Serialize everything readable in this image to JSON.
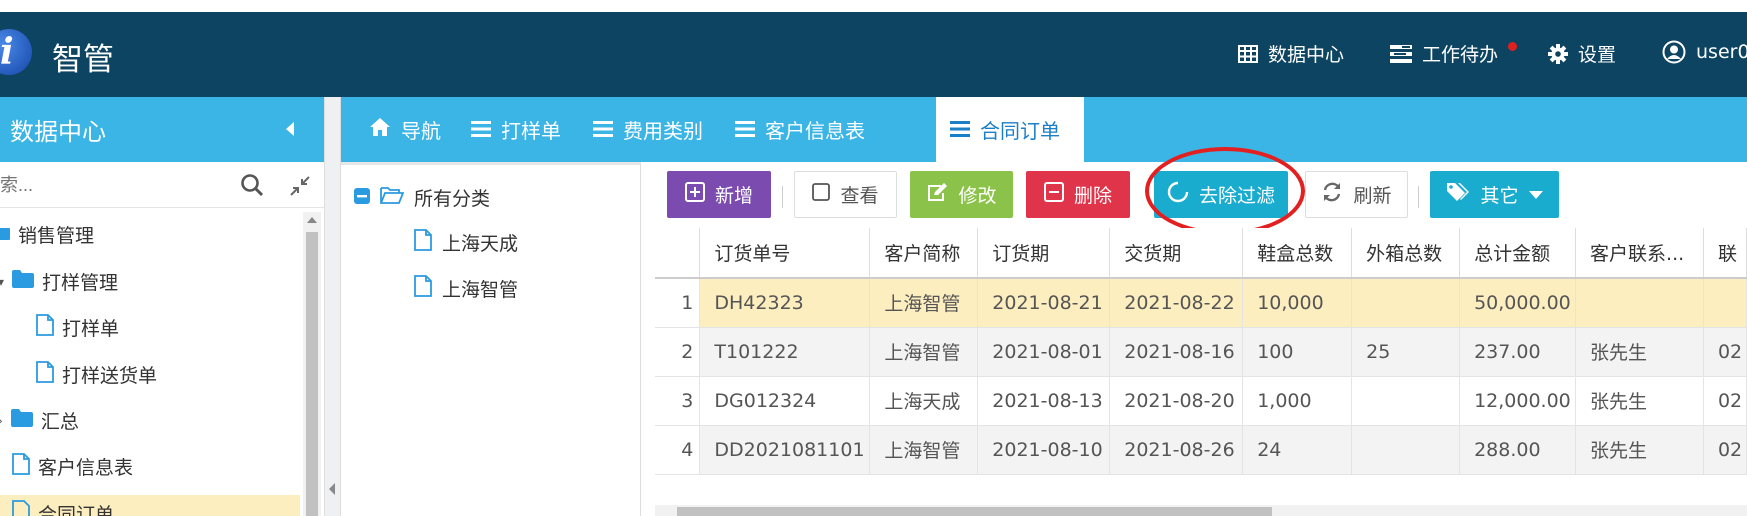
{
  "header": {
    "logo_letter": "i",
    "app_title": "智管",
    "items": [
      {
        "label": "数据中心",
        "icon": "table-icon"
      },
      {
        "label": "工作待办",
        "icon": "tasks-icon"
      },
      {
        "label": "设置",
        "icon": "gear-icon"
      },
      {
        "label": "user0",
        "icon": "user-icon"
      }
    ]
  },
  "sidebar": {
    "title": "数据中心",
    "search_placeholder": "索...",
    "tree": [
      {
        "label": "销售管理",
        "type": "folder-open"
      },
      {
        "label": "打样管理",
        "type": "folder"
      },
      {
        "label": "打样单",
        "type": "file"
      },
      {
        "label": "打样送货单",
        "type": "file"
      },
      {
        "label": "汇总",
        "type": "folder"
      },
      {
        "label": "客户信息表",
        "type": "file"
      },
      {
        "label": "合同订单",
        "type": "file"
      }
    ]
  },
  "tabs": [
    {
      "label": "导航",
      "icon": "home-icon"
    },
    {
      "label": "打样单",
      "icon": "list-icon"
    },
    {
      "label": "费用类别",
      "icon": "list-icon"
    },
    {
      "label": "客户信息表",
      "icon": "list-icon"
    },
    {
      "label": "合同订单",
      "icon": "list-icon",
      "active": true
    }
  ],
  "categories": {
    "root": "所有分类",
    "items": [
      "上海天成",
      "上海智管"
    ]
  },
  "toolbar": {
    "add": "新增",
    "view": "查看",
    "edit": "修改",
    "delete": "删除",
    "clear_filter": "去除过滤",
    "refresh": "刷新",
    "other": "其它"
  },
  "colors": {
    "header_bg": "#0d4462",
    "accent": "#3bb4e6",
    "add": "#7b4bb0",
    "edit": "#8bc34a",
    "delete": "#e0344a",
    "clear_filter": "#1aaccf",
    "other": "#1aaccf",
    "selected_row": "#fdeec0"
  },
  "grid": {
    "columns": [
      "订货单号",
      "客户简称",
      "订货期",
      "交货期",
      "鞋盒总数",
      "外箱总数",
      "总计金额",
      "客户联系...",
      "联"
    ],
    "rows": [
      {
        "n": "1",
        "cells": [
          "DH42323",
          "上海智管",
          "2021-08-21",
          "2021-08-22",
          "10,000",
          "",
          "50,000.00",
          "",
          ""
        ]
      },
      {
        "n": "2",
        "cells": [
          "T101222",
          "上海智管",
          "2021-08-01",
          "2021-08-16",
          "100",
          "25",
          "237.00",
          "张先生",
          "02"
        ]
      },
      {
        "n": "3",
        "cells": [
          "DG012324",
          "上海天成",
          "2021-08-13",
          "2021-08-20",
          "1,000",
          "",
          "12,000.00",
          "张先生",
          "02"
        ]
      },
      {
        "n": "4",
        "cells": [
          "DD2021081101",
          "上海智管",
          "2021-08-10",
          "2021-08-26",
          "24",
          "",
          "288.00",
          "张先生",
          "02"
        ]
      }
    ]
  }
}
